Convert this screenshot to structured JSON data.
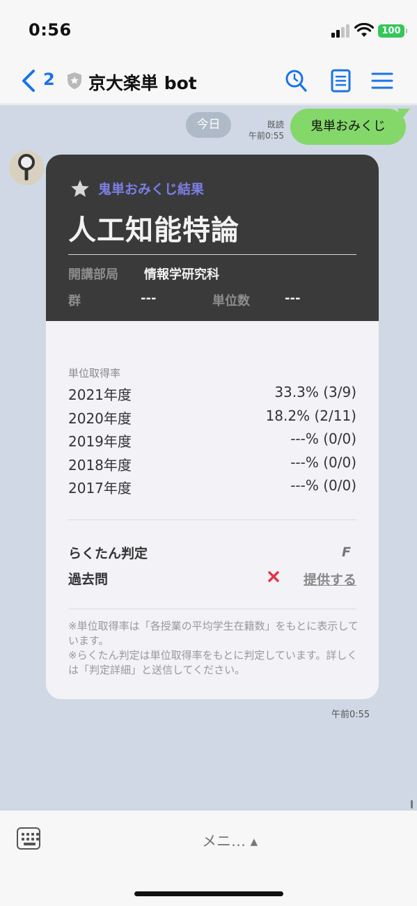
{
  "status_bar": {
    "time": "0:56",
    "battery": "100"
  },
  "header": {
    "back_count": "2",
    "title": "京大楽単 bot"
  },
  "chat": {
    "date_pill": "今日",
    "sent_message": {
      "text": "鬼単おみくじ",
      "read_label": "既読",
      "time": "午前0:55"
    },
    "received_time": "午前0:55",
    "card": {
      "subtitle": "鬼単おみくじ結果",
      "course_name": "人工知能特論",
      "dept_label": "開講部局",
      "dept_value": "情報学研究科",
      "group_label": "群",
      "group_value": "---",
      "credits_label": "単位数",
      "credits_value": "---",
      "rate_label": "単位取得率",
      "rates": [
        {
          "year": "2021年度",
          "value": "33.3% (3/9)"
        },
        {
          "year": "2020年度",
          "value": "18.2% (2/11)"
        },
        {
          "year": "2019年度",
          "value": "---% (0/0)"
        },
        {
          "year": "2018年度",
          "value": "---% (0/0)"
        },
        {
          "year": "2017年度",
          "value": "---% (0/0)"
        }
      ],
      "judge_label": "らくたん判定",
      "judge_grade": "F",
      "past_exam_label": "過去問",
      "provide_link": "提供する",
      "note": "※単位取得率は「各授業の平均学生在籍数」をもとに表示しています。\n※らくたん判定は単位取得率をもとに判定しています。詳しくは「判定詳細」と送信してください。"
    }
  },
  "bottom": {
    "menu_label": "メニ… ▴"
  },
  "colors": {
    "chat_bg": "#cfd8e4",
    "sent_bubble": "#84d86a",
    "card_header": "#3a3a3a",
    "accent_blue": "#1a73e8",
    "subtitle_purple": "#7b7fe6",
    "cross_red": "#e5304a"
  }
}
